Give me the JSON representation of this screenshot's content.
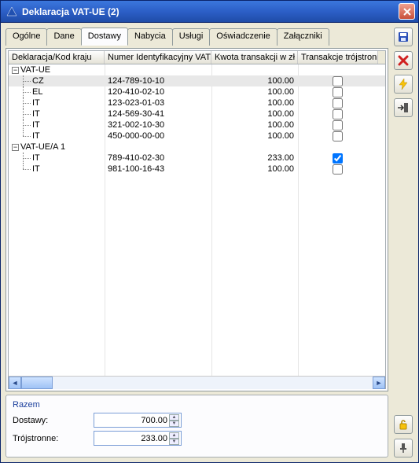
{
  "window": {
    "title": "Deklaracja VAT-UE (2)"
  },
  "tabs": {
    "items": [
      "Ogólne",
      "Dane",
      "Dostawy",
      "Nabycia",
      "Usługi",
      "Oświadczenie",
      "Załączniki"
    ],
    "active_index": 2
  },
  "grid": {
    "columns": [
      "Deklaracja/Kod kraju",
      "Numer Identyfikacyjny VAT",
      "Kwota transakcji w zł",
      "Transakcje trójstronne"
    ],
    "groups": [
      {
        "name": "VAT-UE",
        "expanded": true,
        "rows": [
          {
            "country": "CZ",
            "vat": "124-789-10-10",
            "amount": "100.00",
            "tri": false,
            "selected": true
          },
          {
            "country": "EL",
            "vat": "120-410-02-10",
            "amount": "100.00",
            "tri": false
          },
          {
            "country": "IT",
            "vat": "123-023-01-03",
            "amount": "100.00",
            "tri": false
          },
          {
            "country": "IT",
            "vat": "124-569-30-41",
            "amount": "100.00",
            "tri": false
          },
          {
            "country": "IT",
            "vat": "321-002-10-30",
            "amount": "100.00",
            "tri": false
          },
          {
            "country": "IT",
            "vat": "450-000-00-00",
            "amount": "100.00",
            "tri": false
          }
        ]
      },
      {
        "name": "VAT-UE/A 1",
        "expanded": true,
        "rows": [
          {
            "country": "IT",
            "vat": "789-410-02-30",
            "amount": "233.00",
            "tri": true
          },
          {
            "country": "IT",
            "vat": "981-100-16-43",
            "amount": "100.00",
            "tri": false
          }
        ]
      }
    ]
  },
  "summary": {
    "legend": "Razem",
    "dostawy_label": "Dostawy:",
    "dostawy_value": "700.00",
    "troj_label": "Trójstronne:",
    "troj_value": "233.00"
  },
  "icons": {
    "save": "save-icon",
    "delete": "delete-icon",
    "recalc": "lightning-icon",
    "import": "import-icon",
    "lock": "lock-icon",
    "pin": "pin-icon",
    "close": "close-icon",
    "app": "app-icon"
  }
}
